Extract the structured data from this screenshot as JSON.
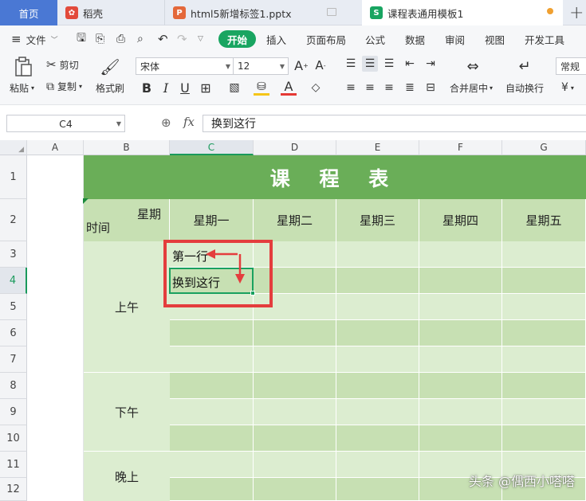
{
  "tabs": {
    "home": "首页",
    "t1": "稻壳",
    "t2": "html5新增标签1.pptx",
    "t3": "课程表通用模板1",
    "plus": "+"
  },
  "menu": {
    "file": "文件",
    "items": [
      "开始",
      "插入",
      "页面布局",
      "公式",
      "数据",
      "审阅",
      "视图",
      "开发工具"
    ]
  },
  "ribbon": {
    "paste": "粘贴",
    "cut": "剪切",
    "copy": "复制",
    "format_painter": "格式刷",
    "font_name": "宋体",
    "font_size": "12",
    "merge_center": "合并居中",
    "wrap_text": "自动换行",
    "number_format": "常规",
    "currency": "¥"
  },
  "formula_bar": {
    "cell_ref": "C4",
    "fx": "fx",
    "content": "换到这行"
  },
  "columns": [
    "A",
    "B",
    "C",
    "D",
    "E",
    "F",
    "G"
  ],
  "rows": [
    "1",
    "2",
    "3",
    "4",
    "5",
    "6",
    "7",
    "8",
    "9",
    "10",
    "11",
    "12"
  ],
  "sheet": {
    "title": "课 程 表",
    "header_week": "星期",
    "header_time": "时间",
    "days": [
      "星期一",
      "星期二",
      "星期三",
      "星期四",
      "星期五"
    ],
    "periods": [
      "上午",
      "下午",
      "晚上"
    ],
    "c3": "第一行",
    "c4": "换到这行"
  },
  "watermark": "头条 @偶西小嗒嗒",
  "colors": {
    "accent": "#19a561",
    "title_bg": "#6aae58",
    "header_bg": "#c7e0b3",
    "annotation": "#e43d3d"
  }
}
